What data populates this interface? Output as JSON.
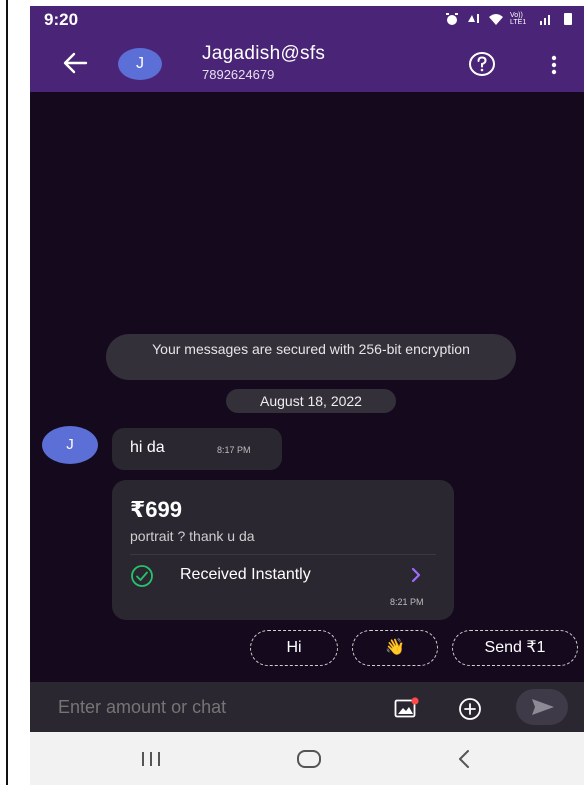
{
  "status_bar": {
    "time": "9:20",
    "network_label": "Vo)) LTE1"
  },
  "header": {
    "avatar_initial": "J",
    "contact_name": "Jagadish@sfs",
    "contact_phone": "7892624679"
  },
  "chat": {
    "encryption_notice": "Your messages are secured with 256-bit encryption",
    "date_label": "August 18, 2022",
    "avatar_initial": "J",
    "message": {
      "text": "hi da",
      "time": "8:17 PM"
    },
    "payment": {
      "amount": "₹699",
      "note": "portrait ? thank u da",
      "status": "Received Instantly",
      "time": "8:21 PM",
      "status_color": "#27c26b",
      "chevron_color": "#9c6bff"
    },
    "quick_replies": {
      "hi": "Hi",
      "wave": "👋",
      "send": "Send ₹1"
    }
  },
  "input": {
    "placeholder": "Enter amount or chat"
  },
  "colors": {
    "header_bg": "#4a2476",
    "chat_bg": "#150a1d",
    "avatar_bg": "#5b6fd6",
    "bubble_bg": "#2a2730"
  },
  "icons": {
    "back": "arrow-left-icon",
    "help": "question-circle-icon",
    "more": "more-vertical-icon",
    "attach_image": "image-icon",
    "add": "plus-circle-icon",
    "send": "send-icon",
    "status_check": "check-circle-icon",
    "nav_recent": "recent-apps-icon",
    "nav_home": "home-icon",
    "nav_back": "nav-back-icon"
  }
}
